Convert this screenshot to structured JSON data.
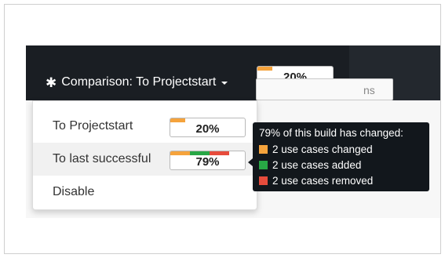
{
  "header": {
    "comparison_label": "Comparison: To Projectstart",
    "percent": "20%",
    "progress": 0.2
  },
  "background": {
    "button_text": "ns"
  },
  "menu": {
    "items": [
      {
        "label": "To Projectstart",
        "percent": "20%",
        "progress": 0.2
      },
      {
        "label": "To last successful",
        "percent": "79%",
        "progress": 0.79
      },
      {
        "label": "Disable"
      }
    ]
  },
  "tooltip": {
    "title": "79% of this build has changed:",
    "lines": [
      {
        "text": "2 use cases changed",
        "color": "#f5a33c"
      },
      {
        "text": "2 use cases added",
        "color": "#28a745"
      },
      {
        "text": "2 use cases removed",
        "color": "#e74c3c"
      }
    ]
  },
  "colors": {
    "changed": "#f5a33c",
    "added": "#28a745",
    "removed": "#e74c3c"
  }
}
